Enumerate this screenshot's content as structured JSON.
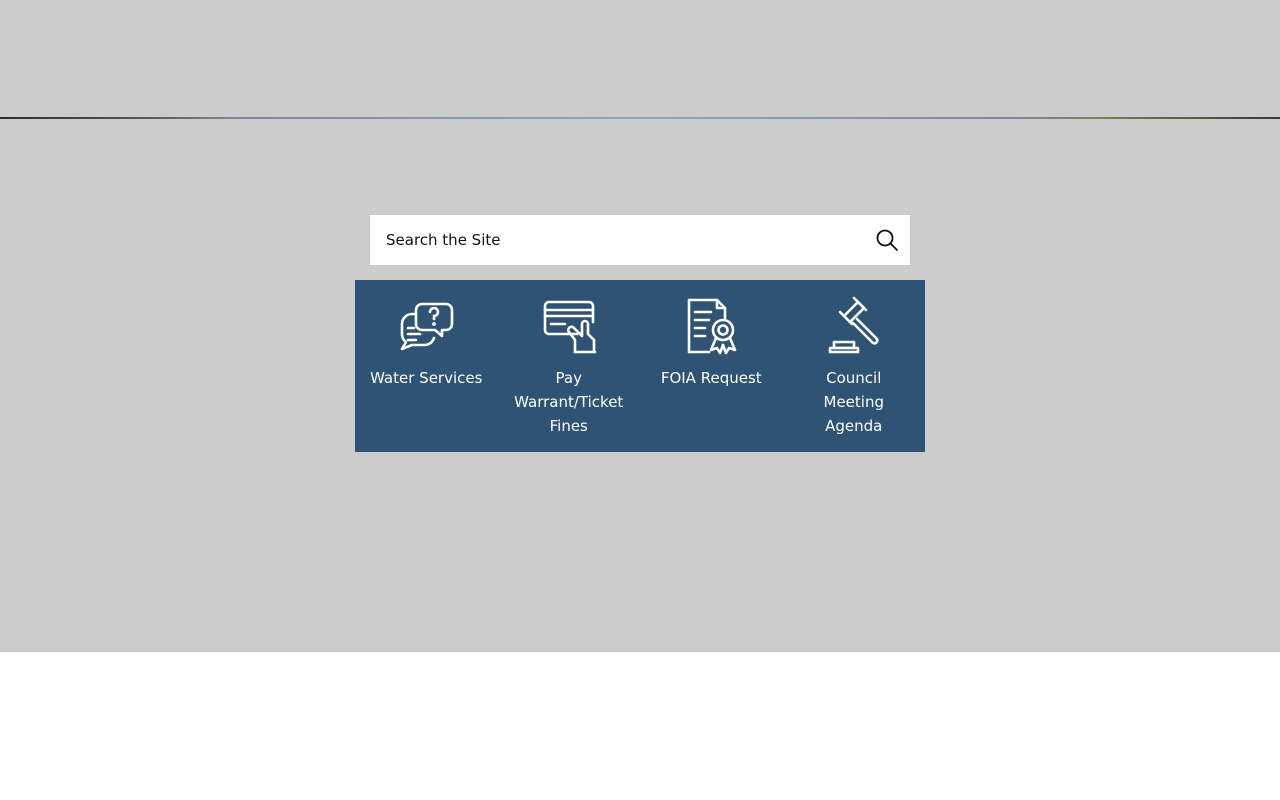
{
  "search": {
    "placeholder": "Search the Site",
    "icon": "search-icon"
  },
  "quick_links": {
    "background_color": "#2e5375",
    "items": [
      {
        "label": "Water Services",
        "icon": "chat-question-icon"
      },
      {
        "label": "Pay Warrant/Ticket Fines",
        "icon": "credit-card-hand-icon"
      },
      {
        "label": "FOIA Request",
        "icon": "certificate-document-icon"
      },
      {
        "label": "Council Meeting Agenda",
        "icon": "gavel-icon"
      }
    ]
  },
  "colors": {
    "hero_background": "#cccccc",
    "page_background": "#ffffff",
    "text_on_panel": "#ffffff"
  }
}
